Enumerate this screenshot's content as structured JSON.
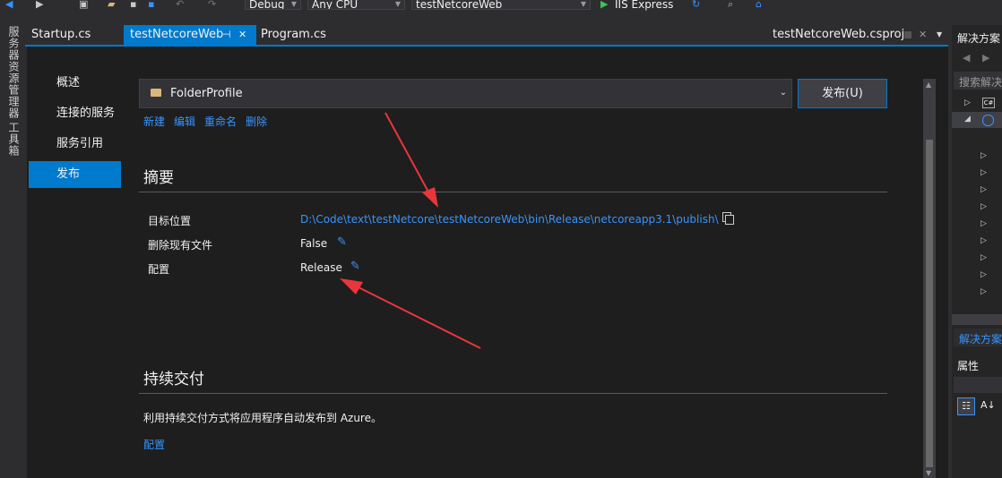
{
  "toolbar": {
    "config": "Debug",
    "platform": "Any CPU",
    "project": "testNetcoreWeb",
    "run": "IIS Express"
  },
  "left_strip": {
    "server_explorer": "服务器资源管理器",
    "toolbox": "工具箱"
  },
  "tabs": {
    "startup": "Startup.cs",
    "active": "testNetcoreWeb",
    "active_pin": "⊣",
    "active_close": "✕",
    "program": "Program.cs",
    "csproj": "testNetcoreWeb.csproj"
  },
  "nav": {
    "overview": "概述",
    "connected_services": "连接的服务",
    "service_references": "服务引用",
    "publish": "发布"
  },
  "profile": {
    "selected": "FolderProfile",
    "publish_button": "发布(U)",
    "actions": [
      "新建",
      "编辑",
      "重命名",
      "删除"
    ]
  },
  "summary": {
    "title": "摘要",
    "target_label": "目标位置",
    "target_value": "D:\\Code\\text\\testNetcore\\testNetcoreWeb\\bin\\Release\\netcoreapp3.1\\publish\\",
    "delete_label": "删除现有文件",
    "delete_value": "False",
    "config_label": "配置",
    "config_value": "Release"
  },
  "cd": {
    "title": "持续交付",
    "desc": "利用持续交付方式将应用程序自动发布到 Azure。",
    "link": "配置"
  },
  "right_panel": {
    "title": "解决方案",
    "search": "搜索解决",
    "tab": "解决方案",
    "properties": "属性"
  },
  "colors": {
    "accent": "#007acc",
    "link": "#3794ff",
    "arrow": "#e8363a"
  }
}
